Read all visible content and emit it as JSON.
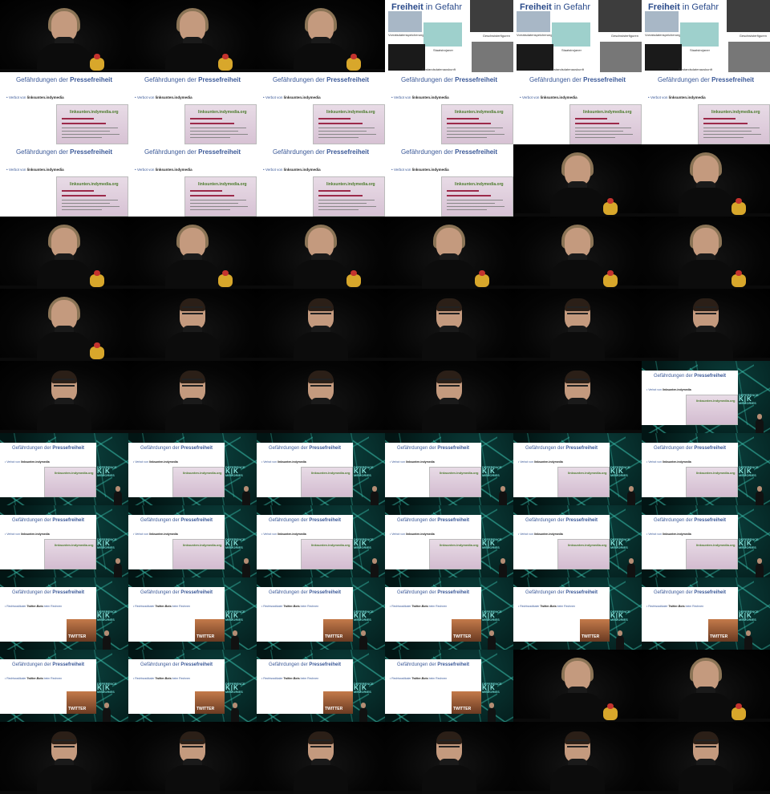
{
  "intro_slide": {
    "title_bold": "Freiheit",
    "title_rest": " in Gefahr",
    "caption_1": "Vorratsdatenspeicherung",
    "caption_2": "Geschwisterfiguren",
    "caption_3": "Staatstrojaner",
    "caption_4": "Bestandsdatenauskunft"
  },
  "slide": {
    "title_prefix": "Gefährdungen der ",
    "title_bold": "Pressefreiheit",
    "bullet_a_prefix": "Verbot von ",
    "bullet_a_bold": "linksunten.indymedia",
    "bullet_b_prefix": "Rechtsradikaler ",
    "bullet_b_bold": "Twitter-Bots",
    "bullet_b_suffix": " beim Rechnen",
    "site_name": "linksunten.indymedia.org",
    "twitter_badge": "TWITTER"
  },
  "conference_logo": {
    "line1": "DEFERENCE",
    "line2": "K|K",
    "line3": "MEMORIES"
  },
  "grid": {
    "columns": 6,
    "rows": 11,
    "cells": [
      "speaker-f",
      "speaker-f",
      "speaker-f",
      "intro",
      "intro",
      "intro",
      "slide-a",
      "slide-a",
      "slide-a",
      "slide-a",
      "slide-a",
      "slide-a",
      "slide-a",
      "slide-a",
      "slide-a",
      "slide-a",
      "speaker-f",
      "speaker-f",
      "speaker-f",
      "speaker-f",
      "speaker-f",
      "speaker-f",
      "speaker-f",
      "speaker-f",
      "speaker-f",
      "speaker-m",
      "speaker-m",
      "speaker-m",
      "speaker-m",
      "speaker-m",
      "speaker-m",
      "speaker-m",
      "speaker-m",
      "speaker-m",
      "speaker-m",
      "stage-a",
      "stage-a",
      "stage-a",
      "stage-a",
      "stage-a",
      "stage-a",
      "stage-a",
      "stage-a",
      "stage-a",
      "stage-a",
      "stage-a",
      "stage-a",
      "stage-a",
      "stage-b",
      "stage-b",
      "stage-b",
      "stage-b",
      "stage-b",
      "stage-b",
      "stage-b",
      "stage-b",
      "stage-b",
      "stage-b",
      "speaker-f",
      "speaker-f",
      "speaker-m",
      "speaker-m",
      "speaker-m",
      "speaker-m",
      "speaker-m",
      "speaker-m"
    ]
  }
}
